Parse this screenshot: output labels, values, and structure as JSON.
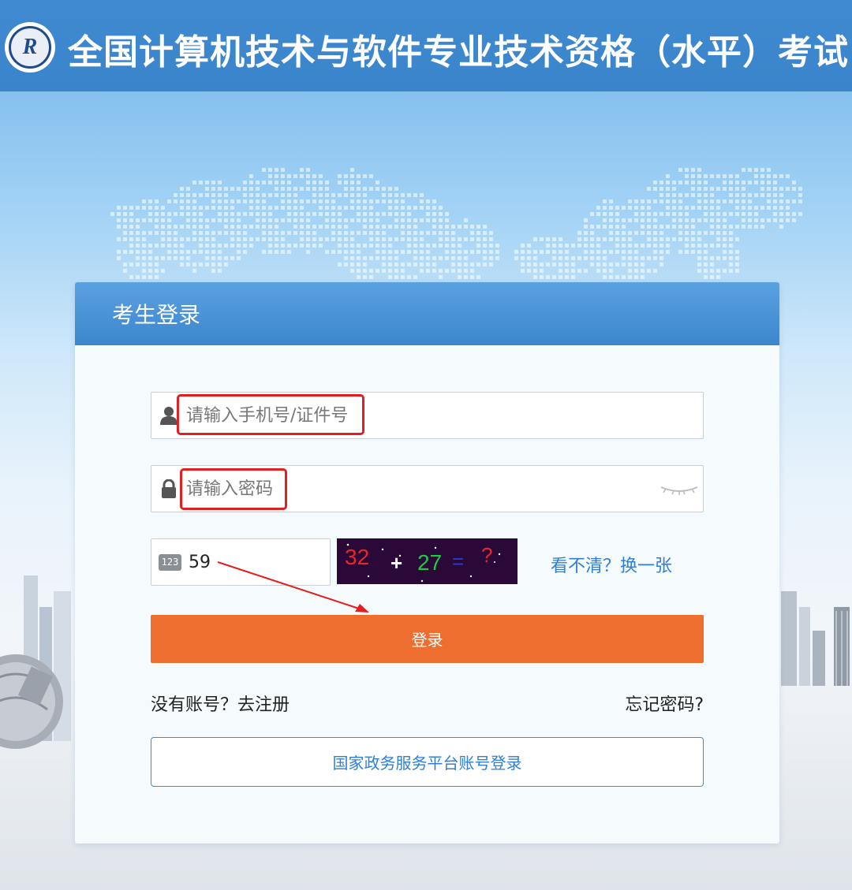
{
  "header": {
    "title": "全国计算机技术与软件专业技术资格（水平）考试",
    "logo_icon": "exam-seal-logo"
  },
  "login": {
    "title": "考生登录",
    "username": {
      "placeholder": "请输入手机号/证件号",
      "value": "",
      "icon": "user-icon"
    },
    "password": {
      "placeholder": "请输入密码",
      "value": "",
      "icon": "lock-icon",
      "toggle_icon": "eye-closed-icon"
    },
    "captcha": {
      "badge": "123",
      "value": "59",
      "image_text": {
        "a": "32",
        "op": "+",
        "b": "27",
        "eq": "=",
        "q": "?"
      },
      "refresh_label": "看不清？换一张"
    },
    "submit_label": "登录",
    "register_label": "没有账号？去注册",
    "forgot_label": "忘记密码?",
    "gov_login_label": "国家政务服务平台账号登录"
  },
  "colors": {
    "header_bg": "#3a84cb",
    "card_header": "#4a94d7",
    "primary_button": "#ee6e30",
    "link": "#2f7fd4",
    "highlight": "#e21f1f"
  }
}
